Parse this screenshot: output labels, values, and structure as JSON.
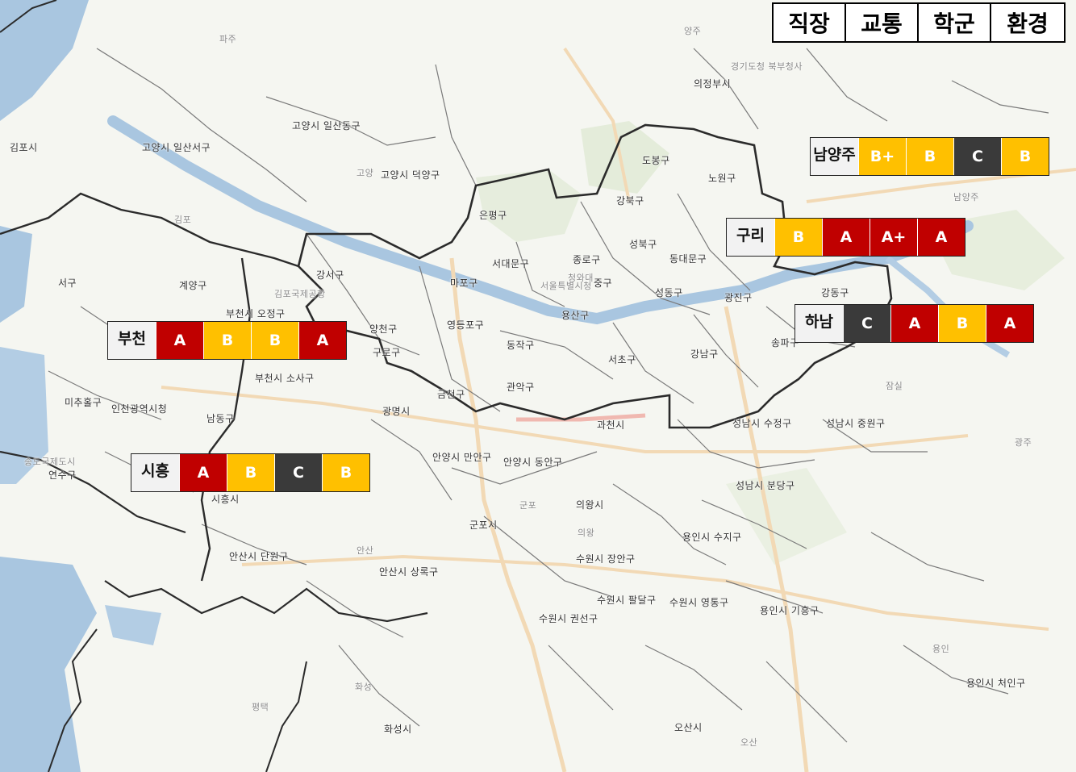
{
  "legend": [
    "직장",
    "교통",
    "학군",
    "환경"
  ],
  "colors": {
    "A+": "#c00000",
    "A": "#c00000",
    "B+": "#ffc000",
    "B": "#ffc000",
    "C": "#3a3a3a"
  },
  "regions": [
    {
      "id": "namyangju",
      "name": "남양주",
      "grades": [
        "B+",
        "B",
        "C",
        "B"
      ]
    },
    {
      "id": "guri",
      "name": "구리",
      "grades": [
        "B",
        "A",
        "A+",
        "A"
      ]
    },
    {
      "id": "hanam",
      "name": "하남",
      "grades": [
        "C",
        "A",
        "B",
        "A"
      ]
    },
    {
      "id": "bucheon",
      "name": "부천",
      "grades": [
        "A",
        "B",
        "B",
        "A"
      ]
    },
    {
      "id": "siheung",
      "name": "시흥",
      "grades": [
        "A",
        "B",
        "C",
        "B"
      ]
    }
  ],
  "map_labels": [
    "고양시 일산동구",
    "고양시 일산서구",
    "김포시",
    "고양시 덕양구",
    "은평구",
    "도봉구",
    "노원구",
    "강북구",
    "성북구",
    "종로구",
    "서대문구",
    "동대문구",
    "마포구",
    "중구",
    "강서구",
    "서구",
    "계양구",
    "양천구",
    "영등포구",
    "구로구",
    "동작구",
    "용산구",
    "성동구",
    "광진구",
    "강동구",
    "서초구",
    "강남구",
    "송파구",
    "금천구",
    "관악구",
    "광명시",
    "과천시",
    "부천시 오정구",
    "부천시 소사구",
    "미추홀구",
    "인천광역시청",
    "남동구",
    "연수구",
    "시흥시",
    "안양시 만안구",
    "안양시 동안구",
    "군포시",
    "의왕시",
    "성남시 수정구",
    "성남시 중원구",
    "성남시 분당구",
    "용인시 수지구",
    "수원시 장안구",
    "수원시 팔달구",
    "수원시 영통구",
    "수원시 권선구",
    "용인시 기흥구",
    "안산시 단원구",
    "안산시 상록구",
    "화성시",
    "오산시",
    "용인시 처인구",
    "의정부시",
    "경기도청 북부청사",
    "파주",
    "양주",
    "고양",
    "김포",
    "남양주",
    "광주",
    "용인",
    "오산",
    "의왕",
    "군포",
    "안산",
    "화성",
    "평택",
    "김포국제공항",
    "잠실",
    "청와대",
    "서울특별시청",
    "송도국제도시"
  ]
}
